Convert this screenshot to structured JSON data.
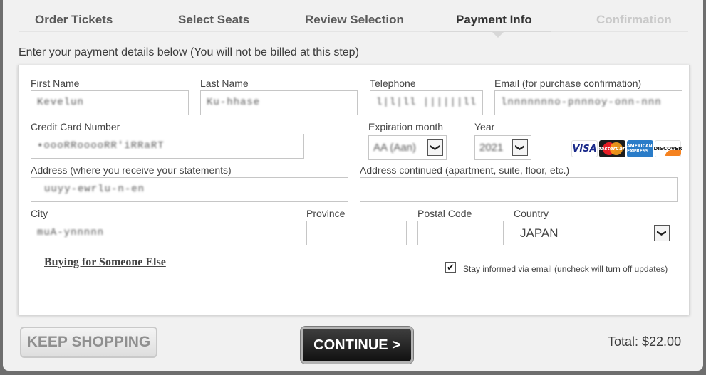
{
  "steps": [
    {
      "label": "Order Tickets",
      "state": "done"
    },
    {
      "label": "Select Seats",
      "state": "done"
    },
    {
      "label": "Review Selection",
      "state": "done"
    },
    {
      "label": "Payment Info",
      "state": "active"
    },
    {
      "label": "Confirmation",
      "state": "disabled"
    }
  ],
  "instructions": "Enter your payment details below (You will not be billed at this step)",
  "form": {
    "first_name": {
      "label": "First Name",
      "value": "Kevelun"
    },
    "last_name": {
      "label": "Last Name",
      "value": "Ku-hhase"
    },
    "telephone": {
      "label": "Telephone",
      "value": "l|l|ll ||||||ll"
    },
    "email": {
      "label": "Email (for purchase confirmation)",
      "value": "lnnnnnnno-pnnnoy-onn-nnn"
    },
    "card_number": {
      "label": "Credit Card Number",
      "value": "•oooRRooooRR'iRRaRT"
    },
    "exp_month": {
      "label": "Expiration month",
      "value": "AA (Aan)"
    },
    "year": {
      "label": "Year",
      "value": "2021"
    },
    "address": {
      "label": "Address (where you receive your statements)",
      "value": "uuyy-ewrlu-n-en"
    },
    "address2": {
      "label": "Address continued (apartment, suite, floor, etc.)",
      "value": ""
    },
    "city": {
      "label": "City",
      "value": "muA-ynnnnn"
    },
    "province": {
      "label": "Province",
      "value": ""
    },
    "postal_code": {
      "label": "Postal Code",
      "value": ""
    },
    "country": {
      "label": "Country",
      "value": "JAPAN"
    }
  },
  "cards": [
    "visa-icon",
    "mastercard-icon",
    "amex-icon",
    "discover-icon"
  ],
  "card_labels": {
    "visa": "VISA",
    "mc": "MasterCard",
    "amex": "AMERICAN EXPRESS",
    "disc": "DISCOVER"
  },
  "buying_for_someone_else": "Buying for Someone Else",
  "stay_informed": {
    "label": "Stay informed via email (uncheck will turn off updates)",
    "checked": true,
    "mark": "✔"
  },
  "arrow_glyph": "❯",
  "buttons": {
    "keep_shopping": "KEEP SHOPPING",
    "continue": "CONTINUE >"
  },
  "total": "Total: $22.00",
  "colors": {
    "accent": "#1e1e1e",
    "page_bg": "#f1f1f1"
  }
}
